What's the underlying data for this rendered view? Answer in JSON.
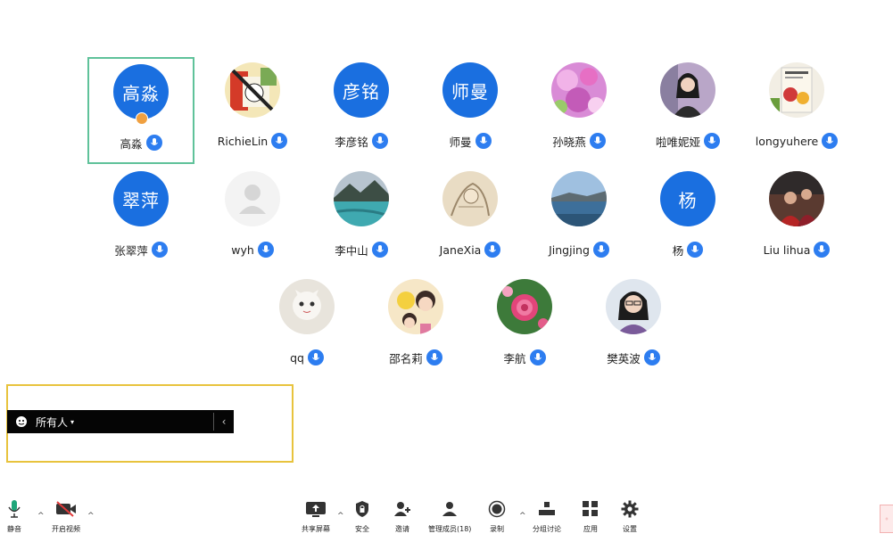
{
  "participants": [
    {
      "name": "高淼",
      "avatar_text": "高淼",
      "active": true,
      "host": true
    },
    {
      "name": "RichieLin",
      "avatar_photo": "richie"
    },
    {
      "name": "李彦铭",
      "avatar_text": "彦铭"
    },
    {
      "name": "师曼",
      "avatar_text": "师曼"
    },
    {
      "name": "孙晓燕",
      "avatar_photo": "flowers"
    },
    {
      "name": "啦唯妮娅",
      "avatar_photo": "woman"
    },
    {
      "name": "longyuhere",
      "avatar_photo": "book"
    },
    {
      "name": "张翠萍",
      "avatar_text": "翠萍"
    },
    {
      "name": "wyh",
      "avatar_photo": "placeholder"
    },
    {
      "name": "李中山",
      "avatar_photo": "lake"
    },
    {
      "name": "JaneXia",
      "avatar_photo": "sketch"
    },
    {
      "name": "Jingjing",
      "avatar_photo": "sea"
    },
    {
      "name": "杨",
      "avatar_text": "杨"
    },
    {
      "name": "Liu lihua",
      "avatar_photo": "red"
    },
    {
      "name": "qq",
      "avatar_photo": "cat"
    },
    {
      "name": "邵名莉",
      "avatar_photo": "anime"
    },
    {
      "name": "李航",
      "avatar_photo": "rose"
    },
    {
      "name": "樊英波",
      "avatar_photo": "glasses"
    }
  ],
  "chat": {
    "recipient": "所有人"
  },
  "toolbar": {
    "mute": "静音",
    "video": "开启视频",
    "share": "共享屏幕",
    "security": "安全",
    "invite": "邀请",
    "members": "管理成员(18)",
    "record": "录制",
    "breakout": "分组讨论",
    "apps": "应用",
    "settings": "设置"
  },
  "colors": {
    "avatar_blue": "#1a6fe0",
    "mic_blue": "#2d7df0",
    "active_border": "#5fc29a",
    "chat_border": "#e8c33d",
    "toolbar_green": "#1fa67a"
  }
}
